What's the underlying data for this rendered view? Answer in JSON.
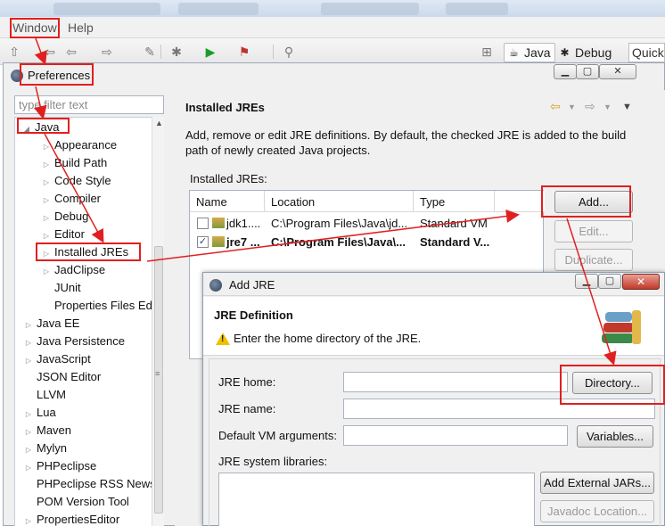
{
  "menubar": {
    "window_label": "Window",
    "help_label": "Help"
  },
  "toolbar": {
    "perspectives": [
      {
        "label": "Java",
        "icon": "java-perspective-icon"
      },
      {
        "label": "Debug",
        "icon": "debug-perspective-icon"
      }
    ],
    "quick_access": "Quick A"
  },
  "preferences": {
    "title": "Preferences",
    "filter_placeholder": "type filter text",
    "tree": [
      {
        "label": "Java",
        "expanded": true,
        "level": 0
      },
      {
        "label": "Appearance",
        "level": 1
      },
      {
        "label": "Build Path",
        "level": 1
      },
      {
        "label": "Code Style",
        "level": 1
      },
      {
        "label": "Compiler",
        "level": 1
      },
      {
        "label": "Debug",
        "level": 1
      },
      {
        "label": "Editor",
        "level": 1
      },
      {
        "label": "Installed JREs",
        "level": 1,
        "selected": true
      },
      {
        "label": "JadClipse",
        "level": 1
      },
      {
        "label": "JUnit",
        "level": 1,
        "leaf": true
      },
      {
        "label": "Properties Files Ed",
        "level": 1,
        "leaf": true
      },
      {
        "label": "Java EE",
        "level": 0
      },
      {
        "label": "Java Persistence",
        "level": 0
      },
      {
        "label": "JavaScript",
        "level": 0
      },
      {
        "label": "JSON Editor",
        "level": 0,
        "leaf": true
      },
      {
        "label": "LLVM",
        "level": 0,
        "leaf": true
      },
      {
        "label": "Lua",
        "level": 0
      },
      {
        "label": "Maven",
        "level": 0
      },
      {
        "label": "Mylyn",
        "level": 0
      },
      {
        "label": "PHPeclipse",
        "level": 0
      },
      {
        "label": "PHPeclipse RSS News",
        "level": 0,
        "leaf": true
      },
      {
        "label": "POM Version Tool",
        "level": 0,
        "leaf": true
      },
      {
        "label": "PropertiesEditor",
        "level": 0
      }
    ],
    "page": {
      "title": "Installed JREs",
      "description_line1": "Add, remove or edit JRE definitions. By default, the checked JRE is added to the build",
      "description_line2": "path of newly created Java projects.",
      "table_label": "Installed JREs:",
      "columns": [
        "Name",
        "Location",
        "Type"
      ],
      "rows": [
        {
          "name": "jdk1....",
          "location": "C:\\Program Files\\Java\\jd...",
          "type": "Standard VM",
          "checked": false
        },
        {
          "name": "jre7 ...",
          "location": "C:\\Program Files\\Java\\...",
          "type": "Standard V...",
          "checked": true
        }
      ],
      "buttons": {
        "add": "Add...",
        "edit": "Edit...",
        "duplicate": "Duplicate..."
      }
    }
  },
  "add_jre": {
    "title": "Add JRE",
    "heading": "JRE Definition",
    "message": "Enter the home directory of the JRE.",
    "fields": {
      "jre_home": "JRE home:",
      "jre_name": "JRE name:",
      "vm_args": "Default VM arguments:",
      "libraries": "JRE system libraries:"
    },
    "buttons": {
      "directory": "Directory...",
      "variables": "Variables...",
      "add_external": "Add External JARs...",
      "javadoc": "Javadoc Location..."
    }
  },
  "colors": {
    "annotation": "#e02020",
    "panel": "#f0f0f0"
  }
}
